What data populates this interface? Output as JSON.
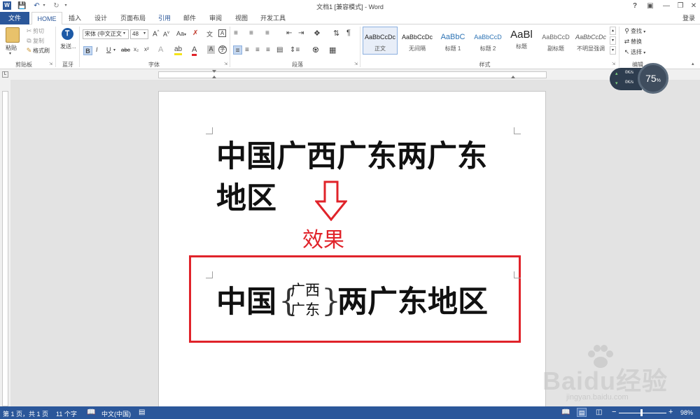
{
  "window": {
    "title": "文档1 [兼容模式] - Word",
    "signin": "登录"
  },
  "quick_access": {
    "save": "保存",
    "undo": "撤销",
    "redo": "恢复"
  },
  "tabs": [
    "文件",
    "HOME",
    "插入",
    "设计",
    "页面布局",
    "引用",
    "邮件",
    "审阅",
    "视图",
    "开发工具"
  ],
  "clipboard": {
    "paste": "粘贴",
    "cut": "剪切",
    "copy": "复制",
    "format_painter": "格式刷",
    "label": "剪贴板"
  },
  "bluetooth": {
    "send": "发送...",
    "label": "蓝牙"
  },
  "font": {
    "name": "宋体 (中文正文",
    "size": "48",
    "label": "字体",
    "aa": "Aa",
    "bold": "B",
    "italic": "I",
    "underline": "U",
    "strike": "abc",
    "sub": "x₂",
    "sup": "x²"
  },
  "paragraph": {
    "label": "段落"
  },
  "styles": {
    "label": "样式",
    "items": [
      {
        "preview": "AaBbCcDc",
        "name": "正文"
      },
      {
        "preview": "AaBbCcDc",
        "name": "无间隔"
      },
      {
        "preview": "AaBbC",
        "name": "标题 1"
      },
      {
        "preview": "AaBbCcD",
        "name": "标题 2"
      },
      {
        "preview": "AaBl",
        "name": "标题"
      },
      {
        "preview": "AaBbCcD",
        "name": "副标题"
      },
      {
        "preview": "AaBbCcDc",
        "name": "不明显强调"
      }
    ]
  },
  "editing": {
    "find": "查找",
    "replace": "替换",
    "select": "选择",
    "label": "编辑"
  },
  "network": {
    "up": "0K/s",
    "down": "0K/s",
    "percent": "75",
    "unit": "%"
  },
  "document": {
    "line1": "中国广西广东两广东",
    "line2": "地区",
    "effect": "效果",
    "result_prefix": "中国",
    "combined_top": "广西",
    "combined_bottom": "广东",
    "result_suffix": "两广东地区"
  },
  "status": {
    "page": "第 1 页，共 1 页",
    "words": "11 个字",
    "language": "中文(中国)",
    "zoom": "98%"
  },
  "watermark": {
    "brand": "Baidu经验",
    "url": "jingyan.baidu.com"
  },
  "colors": {
    "accent": "#2b579a",
    "highlight_box": "#e0232a",
    "arrow": "#e0232a"
  }
}
